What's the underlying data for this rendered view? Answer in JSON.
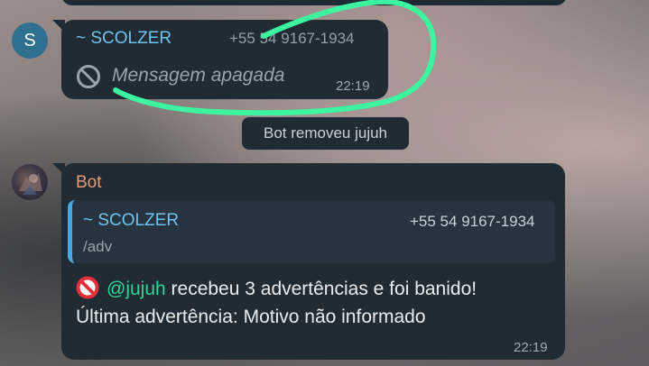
{
  "messages": [
    {
      "avatar_letter": "S",
      "sender": "~ SCOLZER",
      "phone": "+55 54 9167-1934",
      "text": "Mensagem apagada",
      "time": "22:19"
    }
  ],
  "system_message": "Bot removeu jujuh",
  "bot_message": {
    "sender": "Bot",
    "quote": {
      "sender": "~ SCOLZER",
      "phone": "+55 54 9167-1934",
      "text": "/adv"
    },
    "mention": "@jujuh",
    "line1_rest": " recebeu 3 advertências e foi banido!",
    "line2": "Última advertência: Motivo não informado",
    "time": "22:19"
  },
  "colors": {
    "bubble": "#212b33",
    "sender_blue": "#6ec3f0",
    "bot_orange": "#e79c74",
    "mention_green": "#2fd49a",
    "quote_bar": "#4aa9e0",
    "scribble": "#3df5a1"
  },
  "icons": [
    "deleted-message-icon",
    "prohibited-icon"
  ]
}
